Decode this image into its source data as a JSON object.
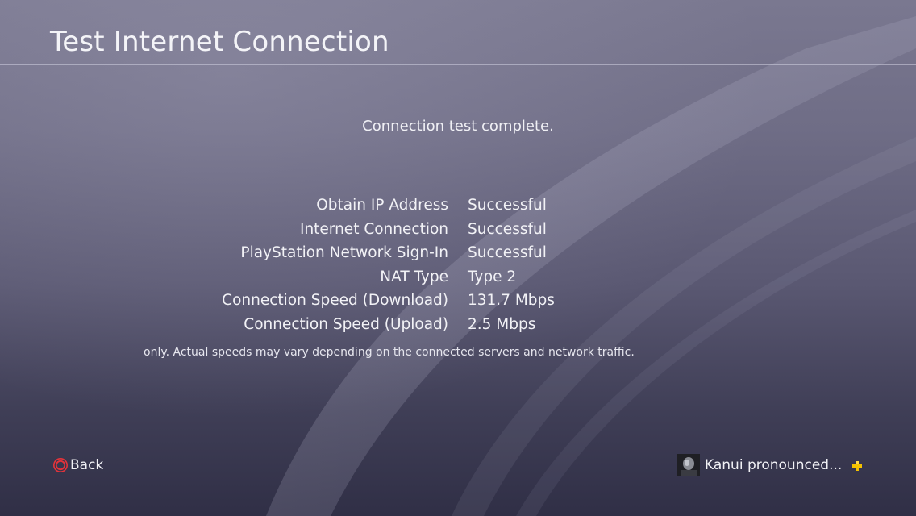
{
  "header": {
    "title": "Test Internet Connection"
  },
  "main": {
    "status": "Connection test complete.",
    "results": [
      {
        "label": "Obtain IP Address",
        "value": "Successful"
      },
      {
        "label": "Internet Connection",
        "value": "Successful"
      },
      {
        "label": "PlayStation Network Sign-In",
        "value": "Successful"
      },
      {
        "label": "NAT Type",
        "value": "Type 2"
      },
      {
        "label": "Connection Speed (Download)",
        "value": "131.7 Mbps"
      },
      {
        "label": "Connection Speed (Upload)",
        "value": "2.5 Mbps"
      }
    ],
    "disclaimer": "only. Actual speeds may vary depending on the connected servers and network traffic."
  },
  "footer": {
    "back_label": "Back",
    "back_icon": "circle-button-icon",
    "user_label": "Kanui pronounced...",
    "plus_icon": "playstation-plus-icon"
  },
  "colors": {
    "circle_button": "#e5333a",
    "plus_gold": "#f4c200"
  }
}
